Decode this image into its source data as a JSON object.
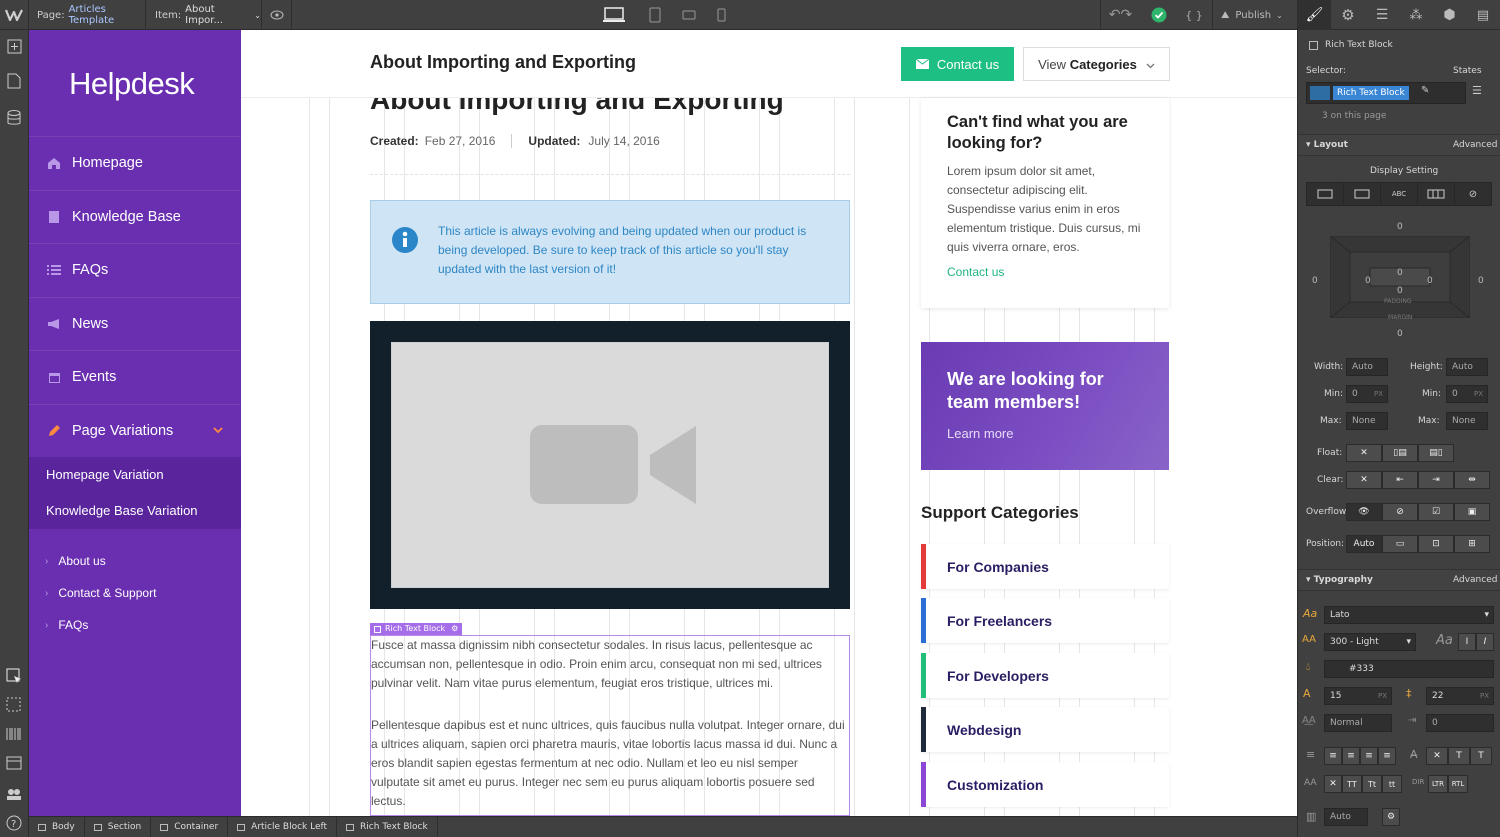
{
  "topbar": {
    "page_label": "Page:",
    "page_value": "Articles Template",
    "item_label": "Item:",
    "item_value": "About Impor...",
    "publish_label": "Publish"
  },
  "sidebar": {
    "brand": "Helpdesk",
    "items": [
      {
        "label": "Homepage",
        "icon": "home-icon"
      },
      {
        "label": "Knowledge Base",
        "icon": "book-icon"
      },
      {
        "label": "FAQs",
        "icon": "list-icon"
      },
      {
        "label": "News",
        "icon": "megaphone-icon"
      },
      {
        "label": "Events",
        "icon": "calendar-icon"
      },
      {
        "label": "Page Variations",
        "icon": "pencil-icon"
      }
    ],
    "subitems": [
      "Homepage Variation",
      "Knowledge Base Variation"
    ],
    "footer_links": [
      "About us",
      "Contact & Support",
      "FAQs"
    ]
  },
  "header": {
    "title": "About Importing and Exporting",
    "contact_button": "Contact us",
    "view_label": "View",
    "categories_label": "Categories"
  },
  "article": {
    "title": "About Importing and Exporting",
    "created_label": "Created:",
    "created_value": "Feb 27, 2016",
    "updated_label": "Updated:",
    "updated_value": "July 14, 2016",
    "notice": "This article is always evolving and being updated when our product is being developed. Be sure to keep track of this article so you'll stay updated with the last version of it!",
    "rich_text_tag": "Rich Text Block",
    "paragraph1": "Fusce at massa dignissim nibh consectetur sodales. In risus lacus, pellentesque ac accumsan non, pellentesque in odio. Proin enim arcu, consequat non mi sed, ultrices pulvinar velit. Nam vitae purus elementum, feugiat eros tristique, ultrices mi.",
    "paragraph2": "Pellentesque dapibus est et nunc ultrices, quis faucibus nulla volutpat. Integer ornare, dui a ultrices aliquam, sapien orci pharetra mauris, vitae lobortis lacus massa id dui. Nunc a eros blandit sapien egestas fermentum at nec odio. Nullam et leo eu nisl semper vulputate sit amet eu purus. Integer nec sem eu purus aliquam lobortis posuere sed lectus."
  },
  "aside": {
    "help_title": "Can't find what you are looking for?",
    "help_body": "Lorem ipsum dolor sit amet, consectetur adipiscing elit. Suspendisse varius enim in eros elementum tristique. Duis cursus, mi quis viverra ornare, eros.",
    "help_link": "Contact us",
    "promo_title": "We are looking for team members!",
    "promo_link": "Learn more",
    "support_title": "Support Categories",
    "categories": [
      {
        "label": "For Companies",
        "color": "#e53a3a"
      },
      {
        "label": "For Freelancers",
        "color": "#2b6fd6"
      },
      {
        "label": "For Developers",
        "color": "#1fbf7a"
      },
      {
        "label": "Webdesign",
        "color": "#1f2b3a"
      },
      {
        "label": "Customization",
        "color": "#8b46d6"
      }
    ]
  },
  "panel": {
    "element_name": "Rich Text Block",
    "selector_label": "Selector:",
    "states_label": "States",
    "selector_chip": "Rich Text Block",
    "on_page": "3 on this page",
    "layout_label": "Layout",
    "advanced_label": "Advanced",
    "display_setting": "Display Setting",
    "margin_values": [
      "0",
      "0",
      "0",
      "0"
    ],
    "padding_values": [
      "0",
      "0",
      "0",
      "0"
    ],
    "padding_label": "PADDING",
    "margin_label": "MARGIN",
    "width_label": "Width:",
    "width_value": "Auto",
    "height_label": "Height:",
    "height_value": "Auto",
    "min_label": "Min:",
    "min_value": "0",
    "max_label": "Max:",
    "max_value": "None",
    "unit_px": "PX",
    "float_label": "Float:",
    "clear_label": "Clear:",
    "overflow_label": "Overflow:",
    "position_label": "Position:",
    "position_value": "Auto",
    "typography_label": "Typography",
    "font_value": "Lato",
    "weight_value": "300 - Light",
    "color_value": "#333",
    "size_value": "15",
    "line_height_value": "22",
    "spacing_value": "Normal",
    "indent_value": "0",
    "columns_value": "Auto"
  },
  "breadcrumbs": [
    "Body",
    "Section",
    "Container",
    "Article Block Left",
    "Rich Text Block"
  ]
}
